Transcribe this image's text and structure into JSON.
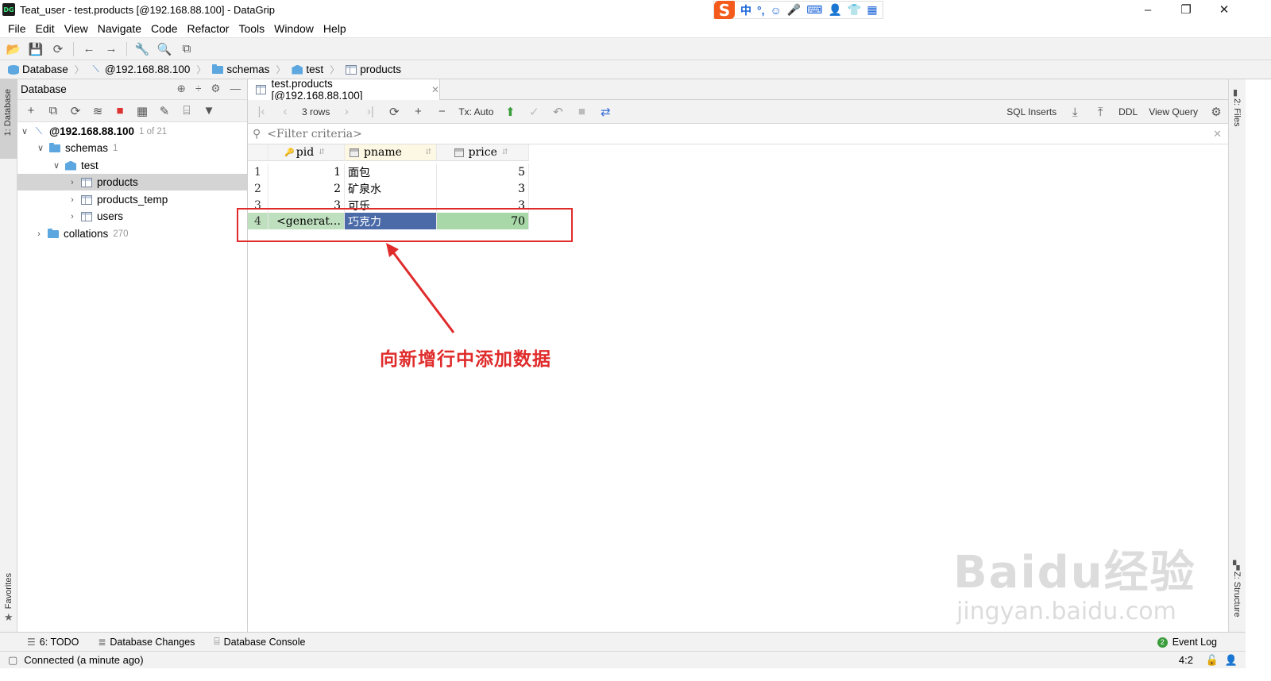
{
  "window": {
    "title": "Teat_user - test.products [@192.168.88.100] - DataGrip",
    "app_badge": "DG",
    "controls": {
      "minimize": "–",
      "maximize": "❐",
      "close": "✕"
    }
  },
  "ime": {
    "logo": "S",
    "mode": "中",
    "punct": "°,",
    "items": [
      "☺",
      "🎤",
      "⌨",
      "👤",
      "👕",
      "▦"
    ]
  },
  "menu": [
    "File",
    "Edit",
    "View",
    "Navigate",
    "Code",
    "Refactor",
    "Tools",
    "Window",
    "Help"
  ],
  "breadcrumb": [
    "Database",
    "@192.168.88.100",
    "schemas",
    "test",
    "products"
  ],
  "database_panel": {
    "title": "Database",
    "tree": {
      "host": "@192.168.88.100",
      "host_count": "1 of 21",
      "schemas_label": "schemas",
      "schemas_count": "1",
      "schema": "test",
      "tables": [
        "products",
        "products_temp",
        "users"
      ],
      "collations_label": "collations",
      "collations_count": "270"
    }
  },
  "editor": {
    "tab_label": "test.products [@192.168.88.100]",
    "rows_label": "3 rows",
    "tx_label": "Tx: Auto",
    "sql_inserts": "SQL Inserts",
    "ddl": "DDL",
    "view_query": "View Query",
    "filter_placeholder": "<Filter criteria>",
    "columns": [
      "pid",
      "pname",
      "price"
    ],
    "rows": [
      {
        "n": "1",
        "pid": "1",
        "pname": "面包",
        "price": "5"
      },
      {
        "n": "2",
        "pid": "2",
        "pname": "矿泉水",
        "price": "3"
      },
      {
        "n": "3",
        "pid": "3",
        "pname": "可乐",
        "price": "3"
      }
    ],
    "new_row": {
      "n": "4",
      "pid": "<generat…",
      "pname": "巧克力",
      "price": "70"
    }
  },
  "annotation": {
    "text": "向新增行中添加数据",
    "color": "#e02b2b"
  },
  "side_tabs": {
    "left_top": "1: Database",
    "left_bottom": "Favorites",
    "right_top": "2: Files",
    "right_bottom": "Z: Structure"
  },
  "bottom_tabs": [
    "6: TODO",
    "Database Changes",
    "Database Console"
  ],
  "event_log": {
    "label": "Event Log",
    "count": "2"
  },
  "status": {
    "text": "Connected (a minute ago)",
    "position": "4:2"
  },
  "watermark": {
    "brand": "Baidu经验",
    "url": "jingyan.baidu.com"
  },
  "colors": {
    "selection": "#4a6aa8",
    "new_row": "#bfe0bf",
    "accent_red": "#e02b2b"
  }
}
